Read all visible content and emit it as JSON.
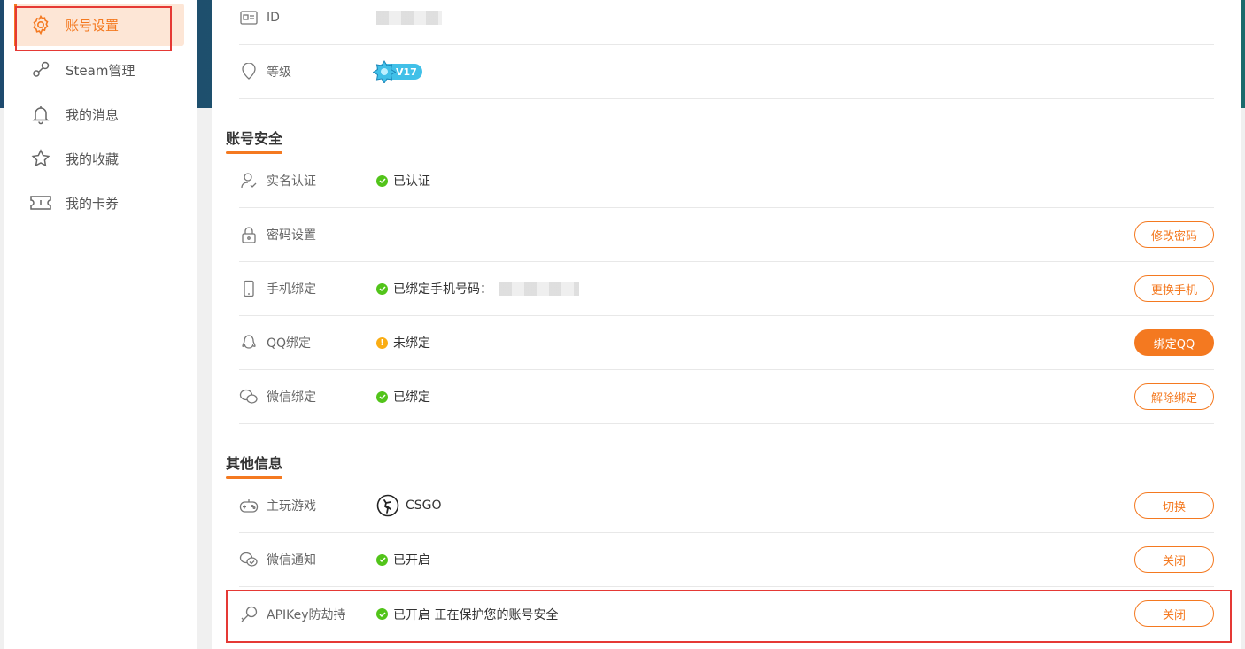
{
  "sidebar": {
    "items": [
      {
        "label": "账号设置",
        "icon": "gear-icon"
      },
      {
        "label": "Steam管理",
        "icon": "steam-icon"
      },
      {
        "label": "我的消息",
        "icon": "bell-icon"
      },
      {
        "label": "我的收藏",
        "icon": "star-icon"
      },
      {
        "label": "我的卡券",
        "icon": "ticket-icon"
      }
    ]
  },
  "profile": {
    "id_label": "ID",
    "level_label": "等级",
    "level_badge": "V17"
  },
  "security": {
    "title": "账号安全",
    "realname": {
      "label": "实名认证",
      "status": "已认证"
    },
    "password": {
      "label": "密码设置",
      "button": "修改密码"
    },
    "phone": {
      "label": "手机绑定",
      "status": "已绑定手机号码：",
      "button": "更换手机"
    },
    "qq": {
      "label": "QQ绑定",
      "status": "未绑定",
      "button": "绑定QQ"
    },
    "wechat": {
      "label": "微信绑定",
      "status": "已绑定",
      "button": "解除绑定"
    }
  },
  "other": {
    "title": "其他信息",
    "game": {
      "label": "主玩游戏",
      "value": "CSGO",
      "button": "切换"
    },
    "wechat_notify": {
      "label": "微信通知",
      "status": "已开启",
      "button": "关闭"
    },
    "apikey": {
      "label": "APIKey防劫持",
      "status": "已开启 正在保护您的账号安全",
      "button": "关闭"
    }
  },
  "colors": {
    "accent": "#f47920",
    "success": "#52c41a",
    "warning": "#faad14",
    "highlight": "#e53935"
  }
}
